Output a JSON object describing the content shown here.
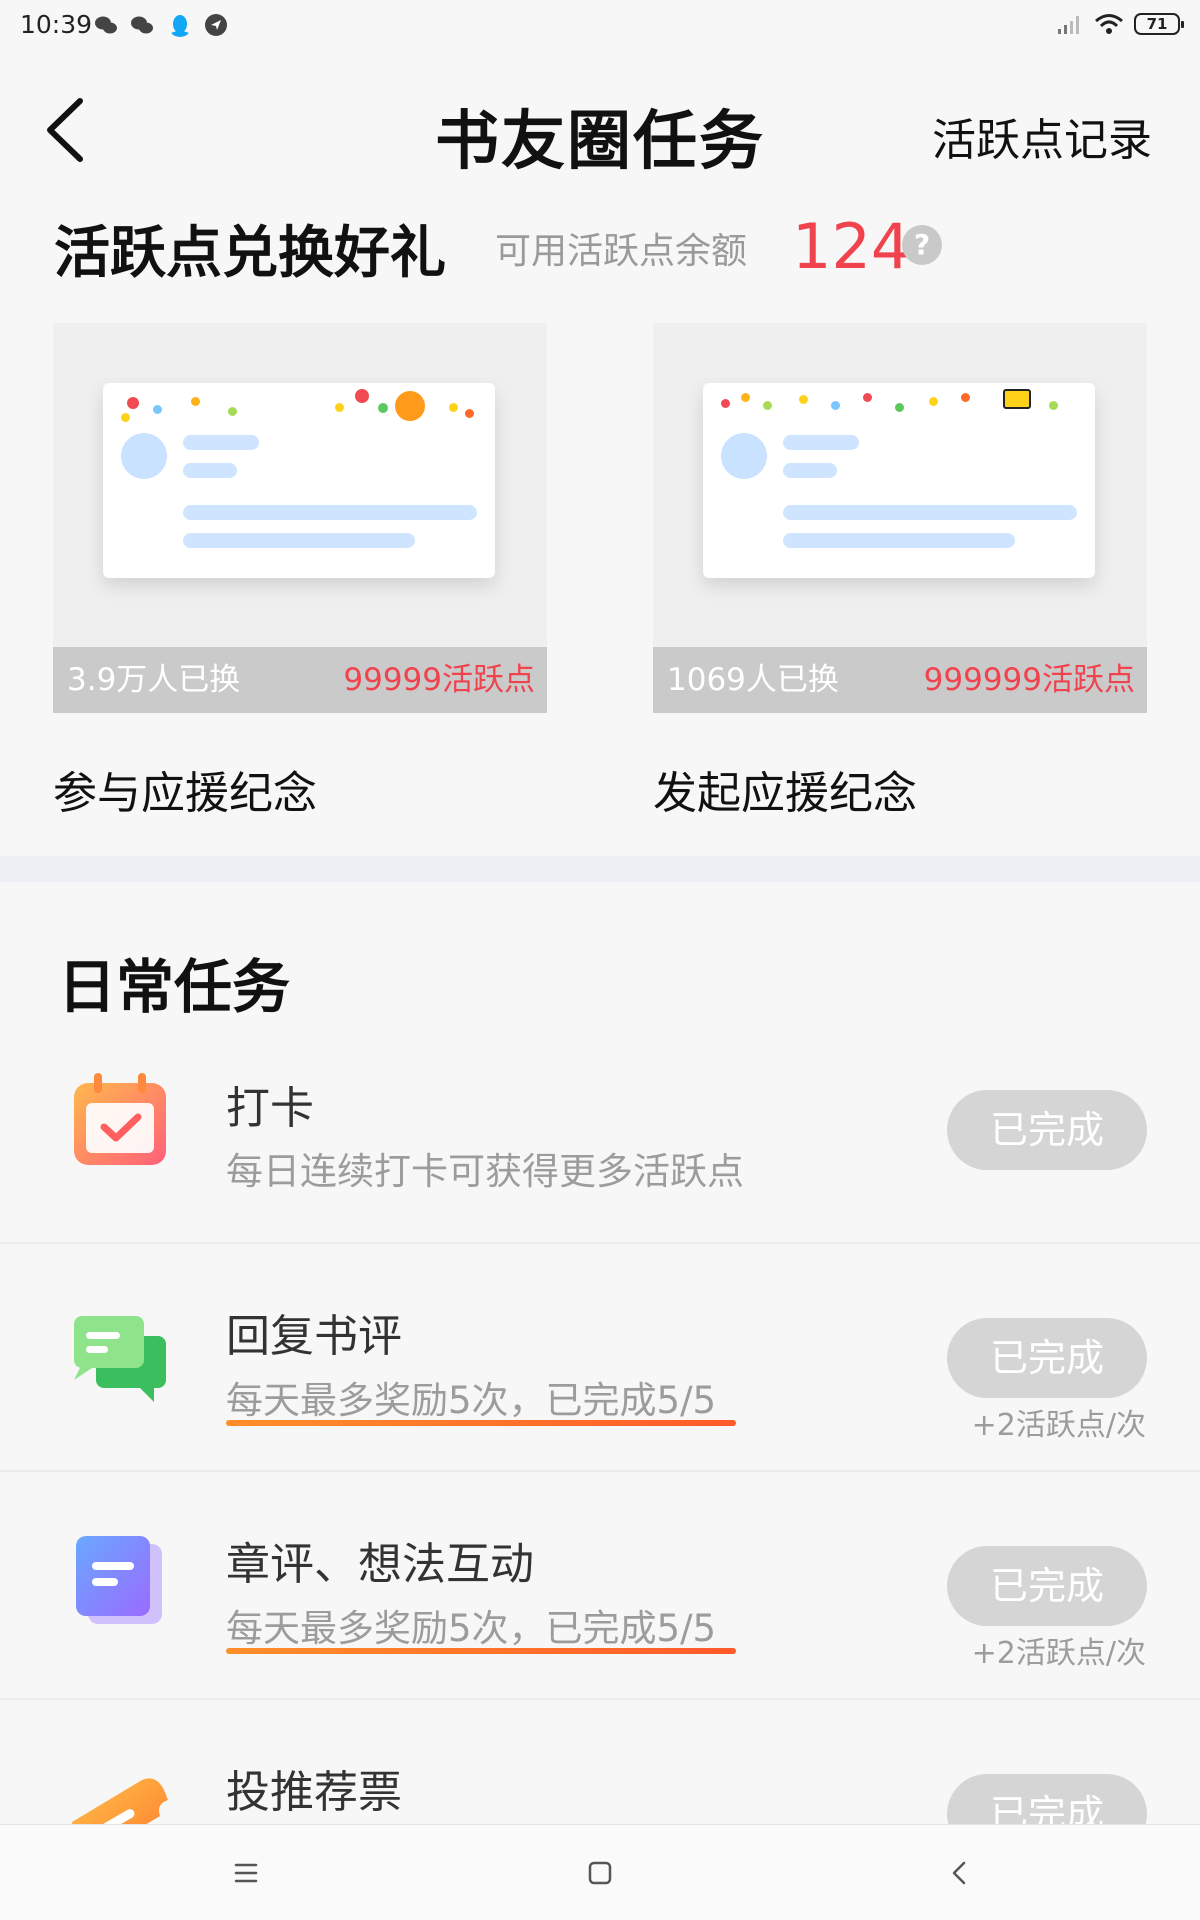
{
  "status_bar": {
    "time": "10:39",
    "battery": "71",
    "icons": [
      "wechat-icon",
      "wechat-icon",
      "qq-icon",
      "location-icon",
      "signal-icon",
      "wifi-icon",
      "battery-icon"
    ]
  },
  "header": {
    "title": "书友圈任务",
    "right_link": "活跃点记录",
    "back_icon": "chevron-left-icon"
  },
  "exchange": {
    "heading": "活跃点兑换好礼",
    "balance_label": "可用活跃点余额",
    "balance_value": "124",
    "help_icon_text": "?",
    "gifts": [
      {
        "count": "3.9万人已换",
        "cost": "99999活跃点",
        "name": "参与应援纪念"
      },
      {
        "count": "1069人已换",
        "cost": "999999活跃点",
        "name": "发起应援纪念"
      }
    ]
  },
  "daily": {
    "heading": "日常任务",
    "tasks": [
      {
        "title": "打卡",
        "desc": "每日连续打卡可获得更多活跃点",
        "button": "已完成",
        "reward": "",
        "icon": "calendar-check-icon"
      },
      {
        "title": "回复书评",
        "desc": "每天最多奖励5次，已完成5/5",
        "button": "已完成",
        "reward": "+2活跃点/次",
        "icon": "chat-bubble-icon",
        "progress": 1.0
      },
      {
        "title": "章评、想法互动",
        "desc": "每天最多奖励5次，已完成5/5",
        "button": "已完成",
        "reward": "+2活跃点/次",
        "icon": "document-icon",
        "progress": 1.0
      },
      {
        "title": "投推荐票",
        "desc": "",
        "button": "已完成",
        "reward": "",
        "icon": "ticket-icon"
      }
    ]
  },
  "nav": {
    "icons": [
      "menu-icon",
      "home-square-icon",
      "back-arrow-icon"
    ]
  },
  "colors": {
    "accent_red": "#f0434e",
    "progress_orange": "#ff7a2a",
    "done_gray": "#d5d5d5"
  }
}
